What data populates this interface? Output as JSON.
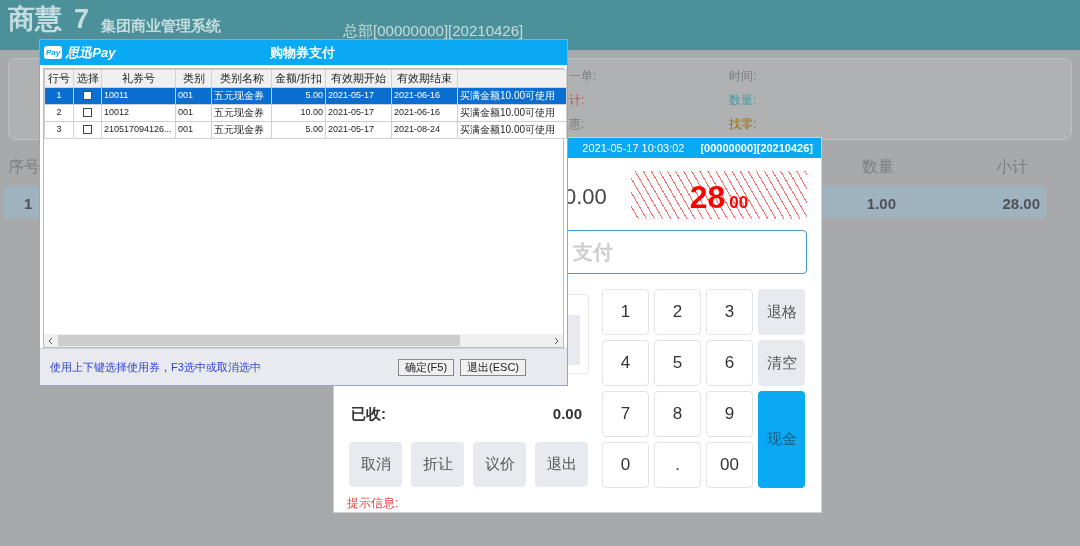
{
  "app_header": {
    "logo": "商慧",
    "logo_version": "7",
    "system_name": "集团商业管理系统",
    "store_info": "总部[00000000][20210426]"
  },
  "summary": [
    {
      "label": "一单:",
      "color": "#7a7b7d"
    },
    {
      "label": "时间:",
      "color": "#7a7b7d"
    },
    {
      "label": "计:",
      "color": "#c0504d"
    },
    {
      "label": "数量:",
      "color": "#4a9aa0"
    },
    {
      "label": "惠:",
      "color": "#7a7b7d"
    },
    {
      "label": "找零:",
      "color": "#9a6f10"
    }
  ],
  "sales_table": {
    "columns": [
      "序号",
      "数量",
      "小计"
    ],
    "rows": [
      {
        "cells": [
          "1",
          "1.00",
          "28.00"
        ],
        "selected": true
      }
    ]
  },
  "payment": {
    "datetime": "2021-05-17 10:03:02",
    "store_code": "[00000000][20210426]",
    "paid_amount": "0.00",
    "due_whole": "28",
    "due_fraction": "00",
    "input": {
      "placeholder": "支付"
    },
    "keypad": [
      {
        "label": "1",
        "kind": "digit"
      },
      {
        "label": "2",
        "kind": "digit"
      },
      {
        "label": "3",
        "kind": "digit"
      },
      {
        "label": "退格",
        "kind": "function"
      },
      {
        "label": "4",
        "kind": "digit"
      },
      {
        "label": "5",
        "kind": "digit"
      },
      {
        "label": "6",
        "kind": "digit"
      },
      {
        "label": "清空",
        "kind": "function"
      },
      {
        "label": "7",
        "kind": "digit"
      },
      {
        "label": "8",
        "kind": "digit"
      },
      {
        "label": "9",
        "kind": "digit"
      },
      {
        "label": "现金",
        "kind": "primary"
      },
      {
        "label": "0",
        "kind": "digit"
      },
      {
        "label": ".",
        "kind": "digit"
      },
      {
        "label": "00",
        "kind": "digit"
      }
    ],
    "received_label": "已收:",
    "received_value": "0.00",
    "actions": [
      "取消",
      "折让",
      "议价",
      "退出"
    ],
    "hint_label": "提示信息:"
  },
  "coupon_dialog": {
    "brand": "思迅Pay",
    "brand_badge": "Pay",
    "title": "购物券支付",
    "columns": [
      "行号",
      "选择",
      "礼券号",
      "类别",
      "类别名称",
      "金额/折扣",
      "有效期开始",
      "有效期结束",
      ""
    ],
    "rows": [
      {
        "selected": true,
        "checked": false,
        "cells": [
          "1",
          "",
          "10011",
          "001",
          "五元现金券",
          "5.00",
          "2021-05-17",
          "2021-06-16",
          "买满金额10.00可使用"
        ]
      },
      {
        "selected": false,
        "checked": false,
        "cells": [
          "2",
          "",
          "10012",
          "001",
          "五元现金券",
          "10.00",
          "2021-05-17",
          "2021-06-16",
          "买满金额10.00可使用"
        ]
      },
      {
        "selected": false,
        "checked": false,
        "cells": [
          "3",
          "",
          "210517094126...",
          "001",
          "五元现金券",
          "5.00",
          "2021-05-17",
          "2021-08-24",
          "买满金额10.00可使用"
        ]
      }
    ],
    "hint": "使用上下键选择使用券，F3选中或取消选中",
    "buttons": [
      "确定(F5)",
      "退出(ESC)"
    ]
  }
}
